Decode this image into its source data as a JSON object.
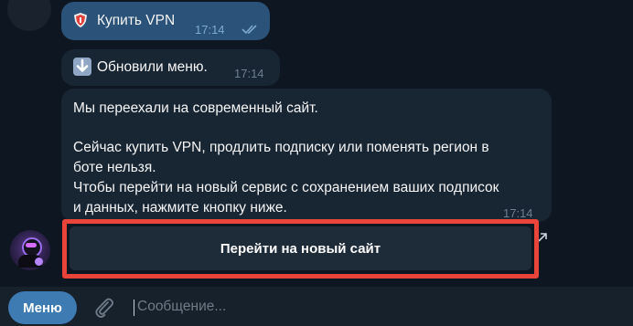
{
  "messages": {
    "outgoing": {
      "icon": "shield-emoji-icon",
      "text": "Купить VPN",
      "time": "17:14"
    },
    "incoming_menu": {
      "icon": "down-arrow-emoji-icon",
      "text": "Обновили меню.",
      "time": "17:14"
    },
    "incoming_notice": {
      "lines": [
        "Мы переехали на современный сайт.",
        "Сейчас купить VPN, продлить подписку или поменять регион в",
        "боте нельзя.",
        "Чтобы перейти на новый сервис с сохранением ваших подписок",
        "и данных, нажмите кнопку ниже."
      ],
      "time": "17:14"
    }
  },
  "inline_button": {
    "label": "Перейти на новый сайт",
    "icon": "external-link-arrow-icon"
  },
  "composer": {
    "menu_label": "Меню",
    "placeholder": "Сообщение..."
  },
  "colors": {
    "chat_background": "#0e1621",
    "outgoing_bubble": "#2b5278",
    "incoming_bubble": "#182533",
    "highlight_border": "#e8443a",
    "menu_button": "#3e7bb3"
  }
}
